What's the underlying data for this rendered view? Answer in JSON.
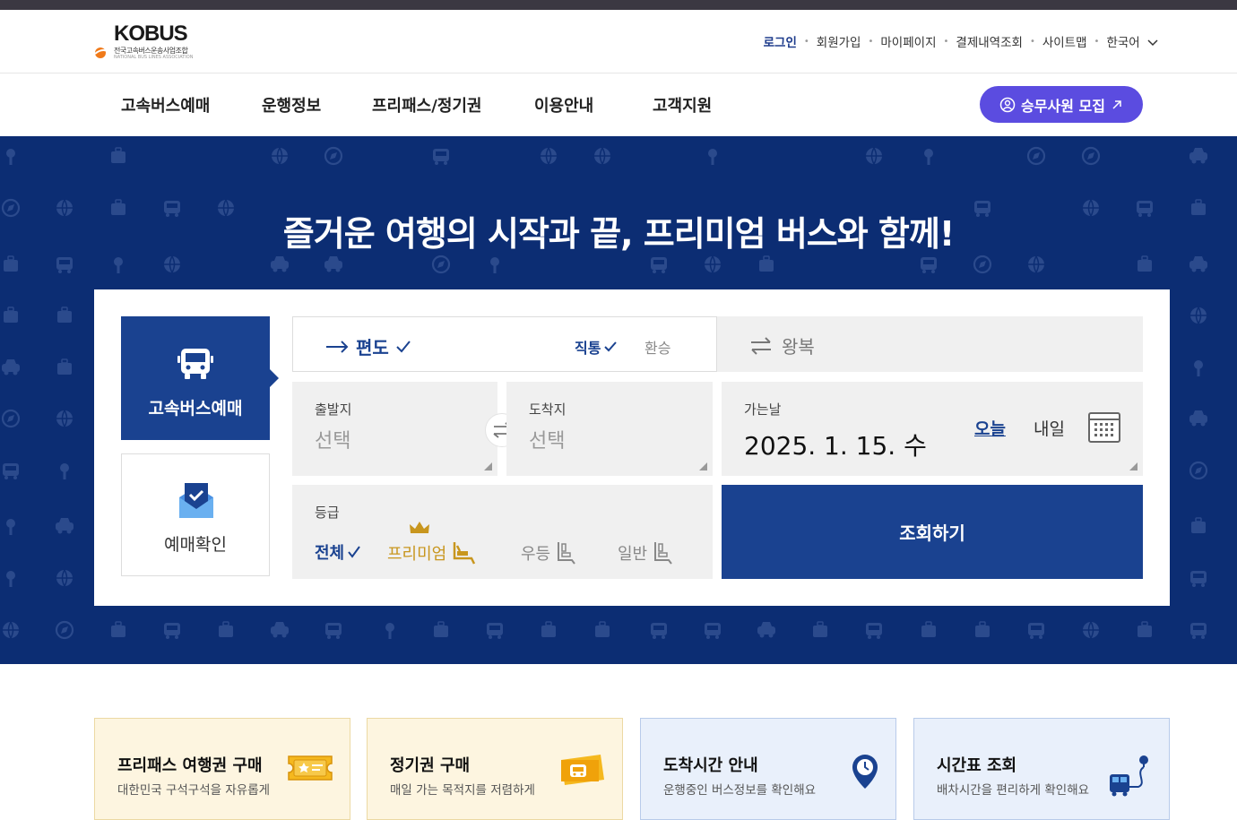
{
  "logo": {
    "name": "KOBUS",
    "subtitle": "전국고속버스운송사업조합",
    "tiny": "NATIONAL BUS LINES ASSOCIATION"
  },
  "util": {
    "login": "로그인",
    "signup": "회원가입",
    "mypage": "마이페이지",
    "payments": "결제내역조회",
    "sitemap": "사이트맵",
    "language": "한국어"
  },
  "gnb": {
    "items": [
      "고속버스예매",
      "운행정보",
      "프리패스/정기권",
      "이용안내",
      "고객지원"
    ],
    "recruit": "승무사원 모집"
  },
  "hero": {
    "title": "즐거운 여행의 시작과 끝, 프리미엄 버스와 함께!"
  },
  "tabs": {
    "booking": "고속버스예매",
    "confirm": "예매확인"
  },
  "trip": {
    "oneway": "편도",
    "direct": "직통",
    "transfer": "환승",
    "round": "왕복"
  },
  "departure": {
    "label": "출발지",
    "placeholder": "선택"
  },
  "arrival": {
    "label": "도착지",
    "placeholder": "선택"
  },
  "date": {
    "label": "가는날",
    "value": "2025. 1. 15. 수",
    "today": "오늘",
    "tomorrow": "내일"
  },
  "grade": {
    "label": "등급",
    "all": "전체",
    "premium": "프리미엄",
    "good": "우등",
    "normal": "일반"
  },
  "search": {
    "label": "조회하기"
  },
  "cards": [
    {
      "title": "프리패스 여행권 구매",
      "sub": "대한민국 구석구석을 자유롭게",
      "icon": "ticket-star-icon"
    },
    {
      "title": "정기권 구매",
      "sub": "매일 가는 목적지를 저렴하게",
      "icon": "ticket-bus-icon"
    },
    {
      "title": "도착시간 안내",
      "sub": "운행중인 버스정보를 확인해요",
      "icon": "location-clock-icon"
    },
    {
      "title": "시간표 조회",
      "sub": "배차시간을 편리하게 확인해요",
      "icon": "bus-route-icon"
    }
  ],
  "colors": {
    "primary": "#1a4290",
    "hero_bg": "#0c2d73",
    "recruit": "#5b4ce0",
    "premium": "#c8961e"
  }
}
